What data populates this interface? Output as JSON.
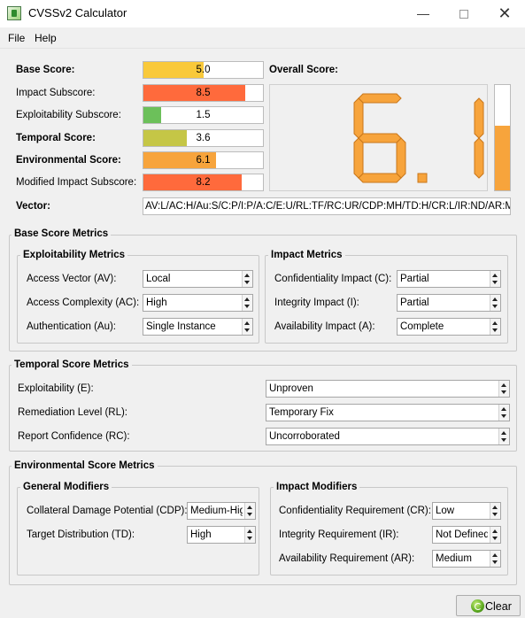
{
  "window": {
    "title": "CVSSv2 Calculator"
  },
  "menu": {
    "file": "File",
    "help": "Help"
  },
  "scores": [
    {
      "label": "Base Score:",
      "value": "5.0",
      "bold": true,
      "color": "#f9c93a",
      "fraction": 0.5
    },
    {
      "label": "Impact Subscore:",
      "value": "8.5",
      "bold": false,
      "color": "#ff6a3c",
      "fraction": 0.85
    },
    {
      "label": "Exploitability Subscore:",
      "value": "1.5",
      "bold": false,
      "color": "#6cc05a",
      "fraction": 0.15
    },
    {
      "label": "Temporal Score:",
      "value": "3.6",
      "bold": true,
      "color": "#c5c646",
      "fraction": 0.36
    },
    {
      "label": "Environmental Score:",
      "value": "6.1",
      "bold": true,
      "color": "#f7a43c",
      "fraction": 0.61
    },
    {
      "label": "Modified Impact Subscore:",
      "value": "8.2",
      "bold": false,
      "color": "#ff6a3c",
      "fraction": 0.82
    }
  ],
  "overall": {
    "label": "Overall Score:",
    "value": "6.1",
    "fraction": 0.61,
    "color": "#f7a43c"
  },
  "vector": {
    "label": "Vector:",
    "value": "AV:L/AC:H/Au:S/C:P/I:P/A:C/E:U/RL:TF/RC:UR/CDP:MH/TD:H/CR:L/IR:ND/AR:M"
  },
  "base_metrics": {
    "title": "Base Score Metrics",
    "exploitability": {
      "title": "Exploitability Metrics",
      "fields": [
        {
          "label": "Access Vector (AV):",
          "value": "Local"
        },
        {
          "label": "Access Complexity (AC):",
          "value": "High"
        },
        {
          "label": "Authentication (Au):",
          "value": "Single Instance"
        }
      ]
    },
    "impact": {
      "title": "Impact Metrics",
      "fields": [
        {
          "label": "Confidentiality Impact (C):",
          "value": "Partial"
        },
        {
          "label": "Integrity Impact (I):",
          "value": "Partial"
        },
        {
          "label": "Availability Impact (A):",
          "value": "Complete"
        }
      ]
    }
  },
  "temporal_metrics": {
    "title": "Temporal Score Metrics",
    "fields": [
      {
        "label": "Exploitability (E):",
        "value": "Unproven"
      },
      {
        "label": "Remediation Level (RL):",
        "value": "Temporary Fix"
      },
      {
        "label": "Report Confidence (RC):",
        "value": "Uncorroborated"
      }
    ]
  },
  "environmental_metrics": {
    "title": "Environmental Score Metrics",
    "general": {
      "title": "General Modifiers",
      "fields": [
        {
          "label": "Collateral Damage Potential (CDP):",
          "value": "Medium-High"
        },
        {
          "label": "Target Distribution (TD):",
          "value": "High"
        }
      ]
    },
    "impact": {
      "title": "Impact Modifiers",
      "fields": [
        {
          "label": "Confidentiality Requirement (CR):",
          "value": "Low"
        },
        {
          "label": "Integrity Requirement (IR):",
          "value": "Not Defined"
        },
        {
          "label": "Availability Requirement (AR):",
          "value": "Medium"
        }
      ]
    }
  },
  "buttons": {
    "clear": "Clear"
  }
}
